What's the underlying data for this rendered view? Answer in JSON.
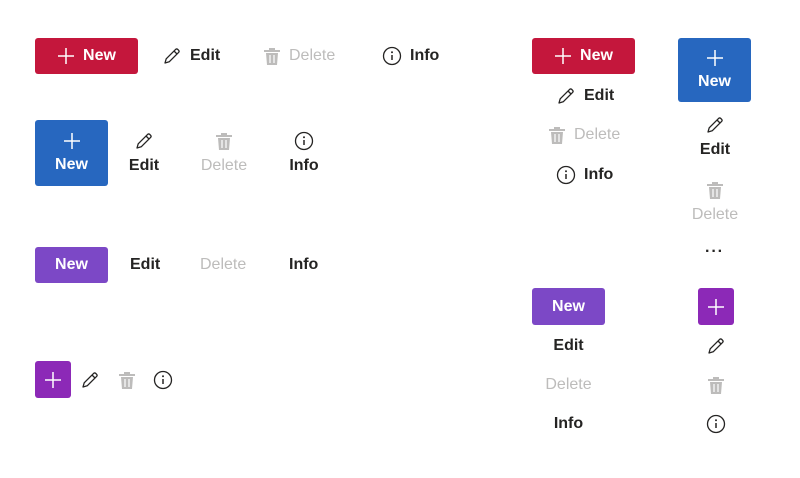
{
  "labels": {
    "new": "New",
    "edit": "Edit",
    "delete": "Delete",
    "info": "Info",
    "more": "···"
  },
  "icons": [
    "plus-icon",
    "pencil-icon",
    "trash-icon",
    "info-icon"
  ],
  "colors": {
    "red": "#c4173c",
    "blue": "#2767bf",
    "purple": "#7c48c6",
    "magenta": "#8c29b7",
    "text": "#252423",
    "disabled": "#bdbcbb"
  }
}
